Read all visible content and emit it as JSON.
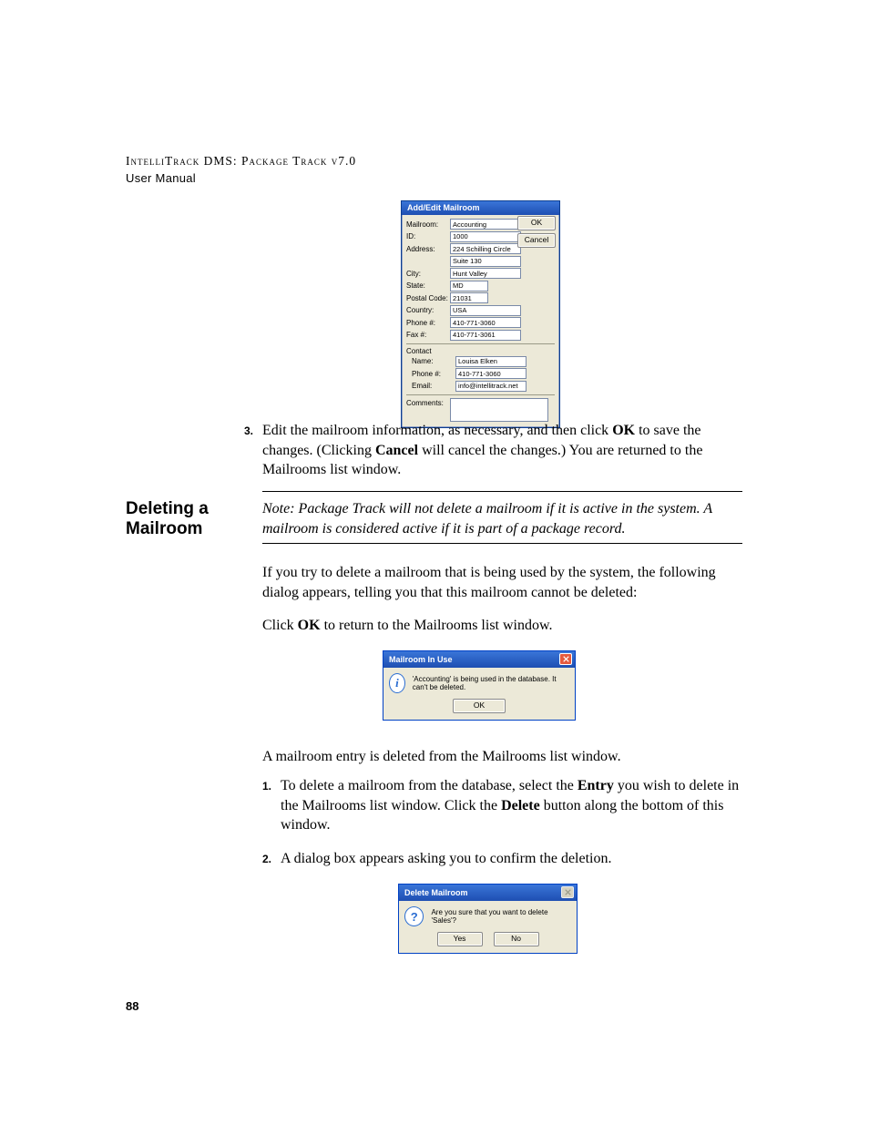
{
  "header": {
    "line1": "IntelliTrack DMS: Package Track v7.0",
    "line2": "User Manual"
  },
  "page_number": "88",
  "edit_dialog": {
    "title": "Add/Edit Mailroom",
    "fields": {
      "mailroom": {
        "label": "Mailroom:",
        "value": "Accounting"
      },
      "id": {
        "label": "ID:",
        "value": "1000"
      },
      "address1": {
        "label": "Address:",
        "value": "224 Schilling Circle"
      },
      "address2": {
        "label": "",
        "value": "Suite 130"
      },
      "city": {
        "label": "City:",
        "value": "Hunt Valley"
      },
      "state": {
        "label": "State:",
        "value": "MD"
      },
      "postal": {
        "label": "Postal Code:",
        "value": "21031"
      },
      "country": {
        "label": "Country:",
        "value": "USA"
      },
      "phone": {
        "label": "Phone #:",
        "value": "410-771-3060"
      },
      "fax": {
        "label": "Fax #:",
        "value": "410-771-3061"
      },
      "contact_header": "Contact",
      "contact_name": {
        "label": "Name:",
        "value": "Louisa Elken"
      },
      "contact_phone": {
        "label": "Phone #:",
        "value": "410-771-3060"
      },
      "contact_email": {
        "label": "Email:",
        "value": "info@intellitrack.net"
      },
      "comments": {
        "label": "Comments:",
        "value": ""
      }
    },
    "buttons": {
      "ok": "OK",
      "cancel": "Cancel"
    }
  },
  "step3": {
    "num": "3.",
    "text_before_ok": "Edit the mailroom information, as necessary, and then click ",
    "ok": "OK",
    "text_mid": " to save the changes. (Clicking ",
    "cancel": "Cancel",
    "text_after": " will cancel the changes.) You are returned to the Mailrooms list window."
  },
  "section": {
    "heading": "Deleting a Mailroom",
    "note": "Note:   Package Track will not delete a mailroom if it is active in the system. A mailroom is considered active if it is part of a package record."
  },
  "para1": "If you try to delete a mailroom that is being used by the system, the following dialog appears, telling you that this mailroom cannot be deleted:",
  "para2_before": "Click ",
  "para2_ok": "OK",
  "para2_after": " to return to the Mailrooms list window.",
  "info_dialog": {
    "title": "Mailroom In Use",
    "message": "'Accounting' is being used in the database. It can't be deleted.",
    "ok": "OK"
  },
  "para3": "A mailroom entry is deleted from the Mailrooms list window.",
  "step1": {
    "num": "1.",
    "t1": "To delete a mailroom from the database, select the ",
    "entry": "Entry",
    "t2": " you wish to delete in the Mailrooms list window. Click the ",
    "del": "Delete",
    "t3": " button along the bottom of this window."
  },
  "step2": {
    "num": "2.",
    "text": "A dialog box appears asking you to confirm the deletion."
  },
  "del_dialog": {
    "title": "Delete Mailroom",
    "message": "Are you sure that you want to delete 'Sales'?",
    "yes": "Yes",
    "no": "No"
  }
}
